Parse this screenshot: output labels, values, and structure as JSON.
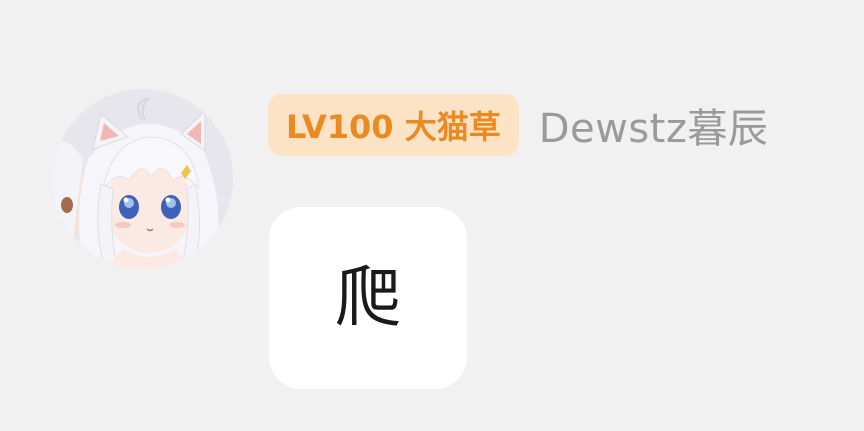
{
  "message": {
    "sender": {
      "level_badge": "LV100 大猫草",
      "username": "Dewstz暮辰",
      "avatar_icon": "anime-cat-girl-avatar"
    },
    "text": "爬"
  },
  "colors": {
    "background": "#f1f1f1",
    "badge_bg": "#fde3c5",
    "badge_text": "#ec8a22",
    "username": "#9a9a9a",
    "bubble_bg": "#ffffff"
  }
}
